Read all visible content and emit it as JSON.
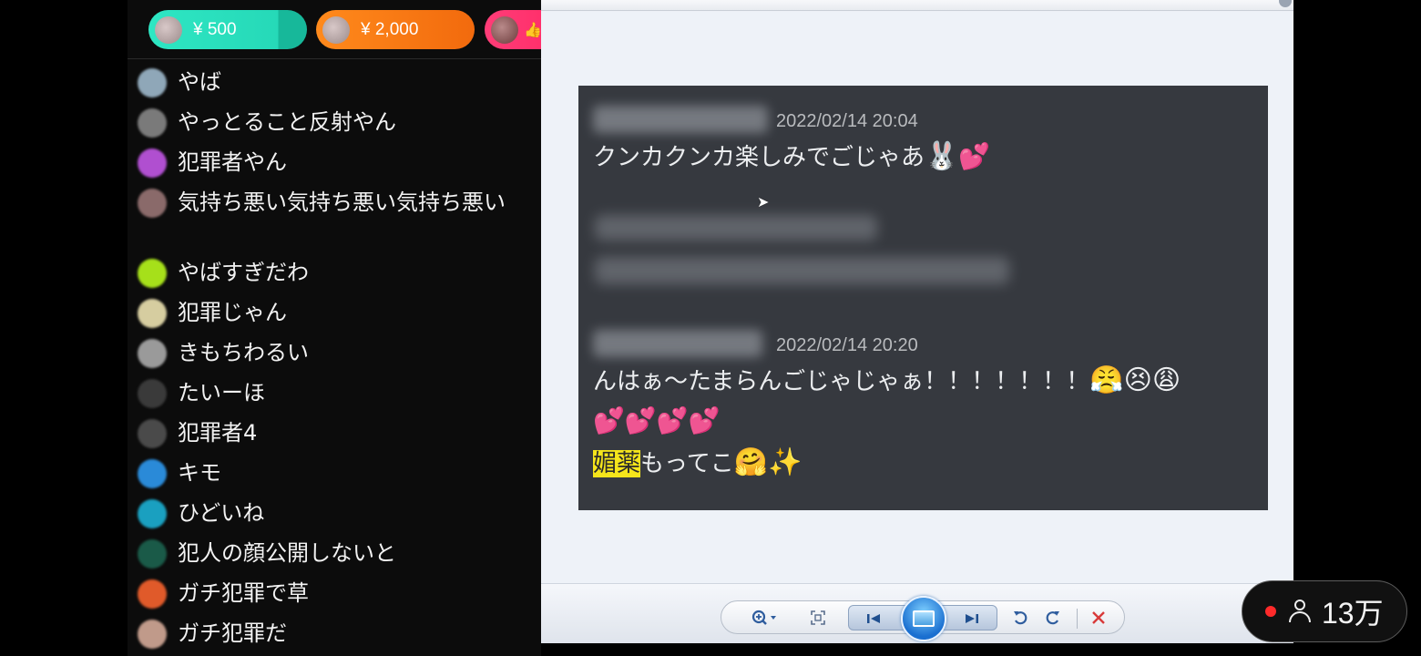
{
  "gifts": [
    {
      "amount": "¥ 500",
      "color": "#2ee6c3"
    },
    {
      "amount": "¥ 2,000",
      "color": "#f26a0d"
    },
    {
      "amount": "",
      "icon": "thumbs-up-icon",
      "color": "#ff2a66"
    }
  ],
  "comments": [
    {
      "text": "やば",
      "avatar_color": "#8fa7b8"
    },
    {
      "text": "やっとること反射やん",
      "avatar_color": "#7a7a7a"
    },
    {
      "text": "犯罪者やん",
      "avatar_color": "#b04fd0"
    },
    {
      "text": "気持ち悪い気持ち悪い気持ち悪い",
      "avatar_color": "#8a6a6a"
    },
    {
      "text": "やばすぎだわ",
      "avatar_color": "#a6e01a"
    },
    {
      "text": "犯罪じゃん",
      "avatar_color": "#d6cda0"
    },
    {
      "text": "きもちわるい",
      "avatar_color": "#9a9a9a"
    },
    {
      "text": "たいーほ",
      "avatar_color": "#3a3a3a"
    },
    {
      "text": "犯罪者4",
      "avatar_color": "#4a4a4a"
    },
    {
      "text": "キモ",
      "avatar_color": "#2a8ad8"
    },
    {
      "text": "ひどいね",
      "avatar_color": "#1aa0c0"
    },
    {
      "text": "犯人の顔公開しないと",
      "avatar_color": "#1a5a48"
    },
    {
      "text": "ガチ犯罪で草",
      "avatar_color": "#e05a2a"
    },
    {
      "text": "ガチ犯罪だ",
      "avatar_color": "#c09a8a"
    }
  ],
  "viewer_window": {
    "messages": [
      {
        "timestamp": "2022/02/14 20:04",
        "text": "クンカクンカ楽しみでごじゃあ",
        "emojis": [
          "🐰",
          "💕"
        ]
      },
      {
        "timestamp": "2022/02/14 20:20",
        "text": "んはぁ〜たまらんごじゃじゃぁ！！！！！！！",
        "emojis": [
          "😤",
          "😣",
          "😩"
        ],
        "hearts": [
          "💕",
          "💕",
          "💕",
          "💕"
        ],
        "highlight": "媚薬",
        "rest": "もってこ",
        "end_emojis": [
          "🤗",
          "✨"
        ]
      }
    ],
    "toolbar": [
      "zoom-icon",
      "fit-window-icon",
      "previous-icon",
      "slideshow-icon",
      "next-icon",
      "rotate-left-icon",
      "rotate-right-icon",
      "delete-icon"
    ]
  },
  "viewers": {
    "count": "13万",
    "live_color": "#ff2a2a"
  }
}
